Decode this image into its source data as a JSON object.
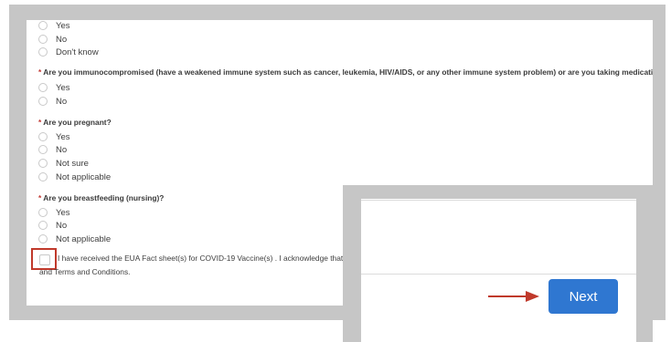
{
  "q0": {
    "options": [
      "Yes",
      "No",
      "Don't know"
    ]
  },
  "q1": {
    "required_mark": "*",
    "question": "Are you immunocompromised (have a weakened immune system such as cancer, leukemia, HIV/AIDS, or any other immune system problem) or are you taking medication that a",
    "options": [
      "Yes",
      "No"
    ]
  },
  "q2": {
    "required_mark": "*",
    "question": "Are you pregnant?",
    "options": [
      "Yes",
      "No",
      "Not sure",
      "Not applicable"
    ]
  },
  "q3": {
    "required_mark": "*",
    "question": "Are you breastfeeding (nursing)?",
    "options": [
      "Yes",
      "No",
      "Not applicable"
    ]
  },
  "consent": {
    "line1": "I have received the EUA Fact sheet(s) for COVID-19 Vaccine(s) . I acknowledge that I have",
    "line2": "and Terms and Conditions."
  },
  "next_button": {
    "label": "Next"
  },
  "colors": {
    "highlight": "#c0392b",
    "button": "#2f77d1",
    "frame": "#c6c6c6"
  }
}
